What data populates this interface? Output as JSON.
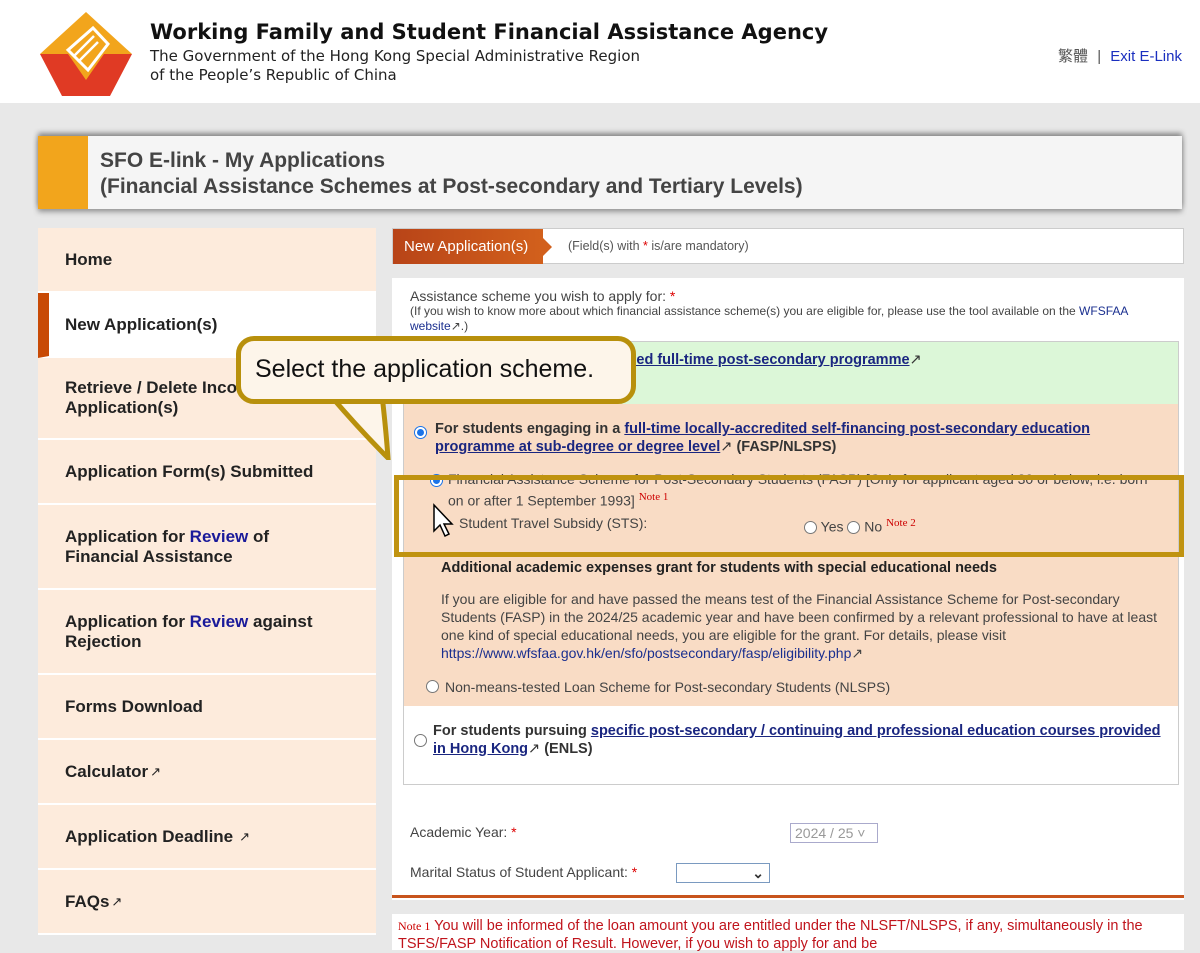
{
  "header": {
    "agency": "Working Family and Student Financial Assistance Agency",
    "gov_line1": "The Government of the Hong Kong Special Administrative Region",
    "gov_line2": "of the People’s Republic of China",
    "lang": "繁體",
    "sep": "|",
    "exit": "Exit E-Link"
  },
  "banner": {
    "line1": "SFO E-link - My Applications",
    "line2": "(Financial Assistance Schemes at Post-secondary and Tertiary Levels)"
  },
  "sidebar": {
    "items": [
      {
        "label": "Home"
      },
      {
        "label": "New Application(s)",
        "active": true
      },
      {
        "label": "Retrieve / Delete Incomplete",
        "label2": "Application(s)"
      },
      {
        "label": "Application Form(s) Submitted"
      },
      {
        "pre": "Application for ",
        "blue": "Review",
        "post": " of",
        "line2": "Financial Assistance"
      },
      {
        "pre": "Application for ",
        "blue": "Review",
        "post": " against",
        "line2": "Rejection"
      },
      {
        "label": "Forms Download"
      },
      {
        "label": "Calculator"
      },
      {
        "label": "Application Deadline"
      },
      {
        "label": "FAQs"
      }
    ]
  },
  "tab": {
    "label": "New Application(s)",
    "mandatory_pre": "(Field(s) with ",
    "star": "*",
    "mandatory_post": " is/are mandatory)"
  },
  "form": {
    "question": "Assistance scheme you wish to apply for: ",
    "hint": "(If you wish to know more about which financial assistance scheme(s) you are eligible for, please use the tool available on the ",
    "hint_link": "WFSFAA website",
    "hint_end": ".)",
    "opt1_link": "recognised publicly-funded full-time post-secondary programme",
    "opt2_pre": "For students engaging in a ",
    "opt2_link": "full-time locally-accredited self-financing post-secondary education programme at sub-degree or degree level",
    "opt2_post": " (FASP/NLSPS)",
    "fasp": "Financial Assistance Scheme for Post-Secondary Students (FASP)  [Only for applicant aged 30 or below, i.e. born on or after 1 September 1993]",
    "note1": "Note 1",
    "sts": "Student Travel Subsidy (STS):",
    "yes": "Yes",
    "no": "No",
    "note2": "Note 2",
    "sen_title": "Additional academic expenses grant for students with special educational needs",
    "sen_text": "If you are eligible for and have passed the means test of the Financial Assistance Scheme for Post-secondary Students (FASP) in the 2024/25 academic year and have been confirmed by a relevant professional to have at least one kind of special educational needs, you are eligible for the grant. For details, please visit ",
    "sen_link": "https://www.wfsfaa.gov.hk/en/sfo/postsecondary/fasp/eligibility.php",
    "nlsps": "Non-means-tested Loan Scheme for Post-secondary Students (NLSPS)",
    "opt3_pre": "For students pursuing ",
    "opt3_link": "specific post-secondary / continuing and professional education courses provided in Hong Kong",
    "opt3_post": " (ENLS)",
    "academic_year_label": "Academic Year: ",
    "academic_year": "2024 / 25",
    "marital_label": "Marital Status of Student Applicant: ",
    "marital_value": ""
  },
  "notes": {
    "label": "Note 1",
    "text": "You will be informed of the loan amount you are entitled under the NLSFT/NLSPS, if any, simultaneously in the TSFS/FASP Notification of Result. However, if you wish to apply for and be"
  },
  "callout": {
    "text": "Select the application scheme."
  },
  "colors": {
    "accent": "#c84a05",
    "banner_bar": "#f2a51c",
    "highlight": "#c09310",
    "link": "#1a2680"
  }
}
